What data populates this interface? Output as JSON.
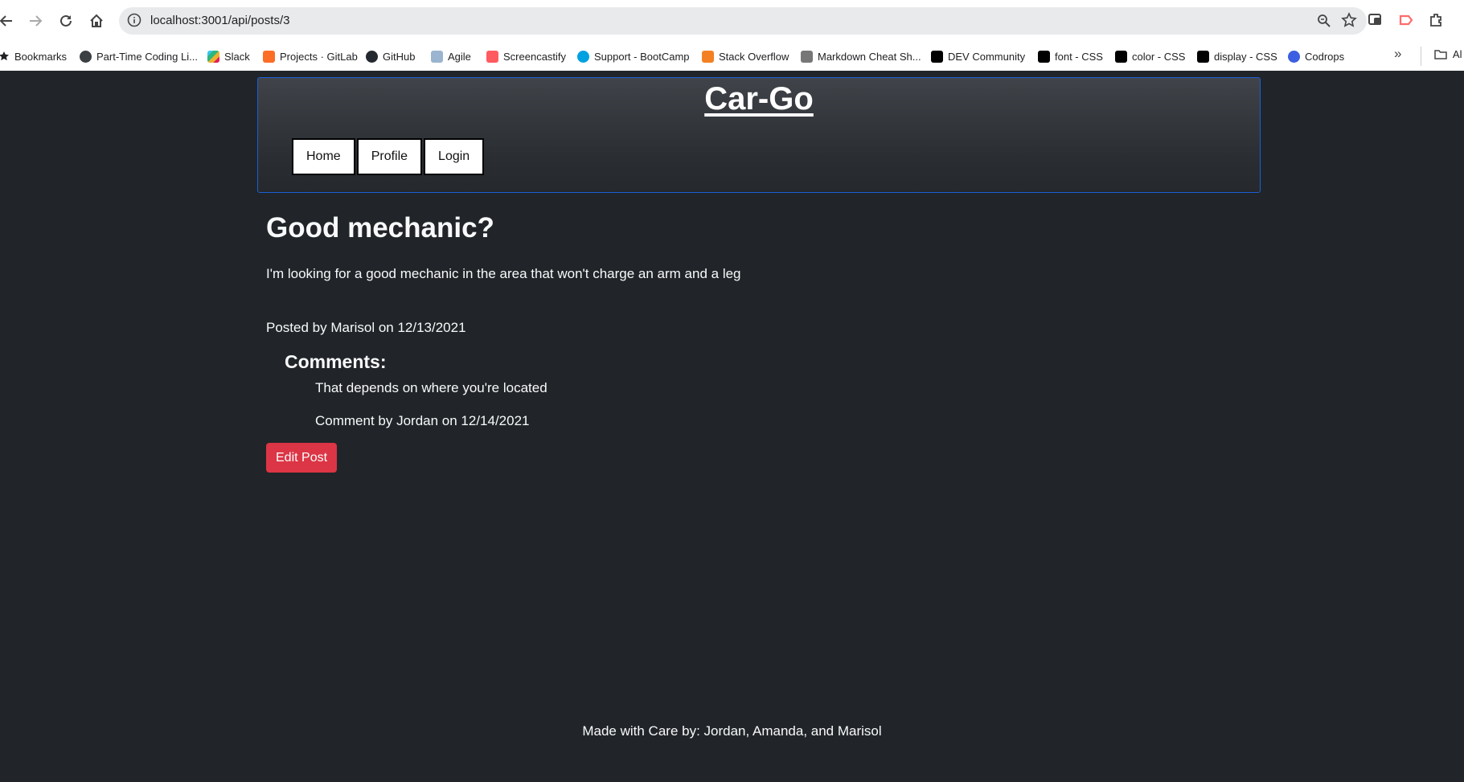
{
  "browser": {
    "url": "localhost:3001/api/posts/3",
    "bookmarks": [
      {
        "label": "Bookmarks",
        "icon": "star-icon",
        "color": "#202124"
      },
      {
        "label": "Part-Time Coding Li...",
        "icon": "globe-icon",
        "color": "#3c4043"
      },
      {
        "label": "Slack",
        "icon": "slack-icon",
        "color": "#e01e5a"
      },
      {
        "label": "Projects · GitLab",
        "icon": "gitlab-icon",
        "color": "#fc6d26"
      },
      {
        "label": "GitHub",
        "icon": "github-icon",
        "color": "#24292f"
      },
      {
        "label": "Agile",
        "icon": "agile-icon",
        "color": "#4a90d9"
      },
      {
        "label": "Screencastify",
        "icon": "screencastify-icon",
        "color": "#ff5a5f"
      },
      {
        "label": "Support - BootCamp",
        "icon": "salesforce-icon",
        "color": "#00a1e0"
      },
      {
        "label": "Stack Overflow",
        "icon": "stackoverflow-icon",
        "color": "#f48024"
      },
      {
        "label": "Markdown Cheat Sh...",
        "icon": "markdown-icon",
        "color": "#555555"
      },
      {
        "label": "DEV Community",
        "icon": "dev-icon",
        "color": "#000000"
      },
      {
        "label": "font - CSS",
        "icon": "mdn-icon",
        "color": "#000000"
      },
      {
        "label": "color - CSS",
        "icon": "mdn-icon",
        "color": "#000000"
      },
      {
        "label": "display - CSS",
        "icon": "mdn-icon",
        "color": "#000000"
      },
      {
        "label": "Codrops",
        "icon": "codrops-icon",
        "color": "#3b5fe0"
      }
    ],
    "all_bookmarks": "Al"
  },
  "site": {
    "title": "Car-Go",
    "nav": [
      "Home",
      "Profile",
      "Login"
    ]
  },
  "post": {
    "title": "Good mechanic?",
    "body": "I'm looking for a good mechanic in the area that won't charge an arm and a leg",
    "meta": "Posted by Marisol on 12/13/2021"
  },
  "comments": {
    "heading": "Comments:",
    "items": [
      {
        "text": "That depends on where you're located",
        "meta": "Comment by Jordan on 12/14/2021"
      }
    ]
  },
  "actions": {
    "edit_label": "Edit Post"
  },
  "footer": {
    "text": "Made with Care by: Jordan, Amanda, and Marisol"
  },
  "colors": {
    "page_bg": "#212529",
    "header_border": "#1b5ed6",
    "edit_button": "#dc3545"
  }
}
